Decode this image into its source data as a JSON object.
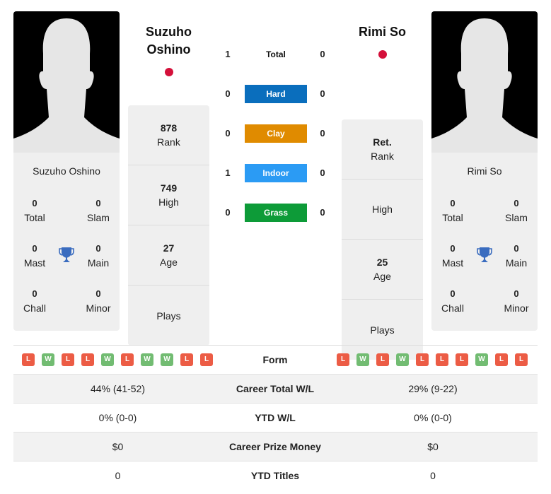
{
  "colors": {
    "hard": "#0a6ebd",
    "clay": "#e08b00",
    "indoor": "#2b9bf4",
    "grass": "#0d9b38",
    "loss": "#ec5c45",
    "win": "#72bc72",
    "flag": "#d4103a",
    "trophy": "#3a6cbf"
  },
  "player1": {
    "name_line1": "Suzuho",
    "name_line2": "Oshino",
    "card_name": "Suzuho Oshino",
    "titles": {
      "total": {
        "value": "0",
        "label": "Total"
      },
      "slam": {
        "value": "0",
        "label": "Slam"
      },
      "mast": {
        "value": "0",
        "label": "Mast"
      },
      "main": {
        "value": "0",
        "label": "Main"
      },
      "chall": {
        "value": "0",
        "label": "Chall"
      },
      "minor": {
        "value": "0",
        "label": "Minor"
      }
    },
    "info": {
      "rank": {
        "value": "878",
        "label": "Rank"
      },
      "high": {
        "value": "749",
        "label": "High"
      },
      "age": {
        "value": "27",
        "label": "Age"
      },
      "plays": {
        "value": "",
        "label": "Plays"
      }
    },
    "form": [
      "L",
      "W",
      "L",
      "L",
      "W",
      "L",
      "W",
      "W",
      "L",
      "L"
    ]
  },
  "player2": {
    "name": "Rimi So",
    "card_name": "Rimi So",
    "titles": {
      "total": {
        "value": "0",
        "label": "Total"
      },
      "slam": {
        "value": "0",
        "label": "Slam"
      },
      "mast": {
        "value": "0",
        "label": "Mast"
      },
      "main": {
        "value": "0",
        "label": "Main"
      },
      "chall": {
        "value": "0",
        "label": "Chall"
      },
      "minor": {
        "value": "0",
        "label": "Minor"
      }
    },
    "info": {
      "rank": {
        "value": "Ret.",
        "label": "Rank"
      },
      "high": {
        "value": "",
        "label": "High"
      },
      "age": {
        "value": "25",
        "label": "Age"
      },
      "plays": {
        "value": "",
        "label": "Plays"
      }
    },
    "form": [
      "L",
      "W",
      "L",
      "W",
      "L",
      "L",
      "L",
      "W",
      "L",
      "L"
    ]
  },
  "h2h": {
    "total": {
      "label": "Total",
      "p1": "1",
      "p2": "0"
    },
    "hard": {
      "label": "Hard",
      "p1": "0",
      "p2": "0"
    },
    "clay": {
      "label": "Clay",
      "p1": "0",
      "p2": "0"
    },
    "indoor": {
      "label": "Indoor",
      "p1": "1",
      "p2": "0"
    },
    "grass": {
      "label": "Grass",
      "p1": "0",
      "p2": "0"
    }
  },
  "table": {
    "form_label": "Form",
    "rows": [
      {
        "label": "Career Total W/L",
        "p1": "44% (41-52)",
        "p2": "29% (9-22)"
      },
      {
        "label": "YTD W/L",
        "p1": "0% (0-0)",
        "p2": "0% (0-0)"
      },
      {
        "label": "Career Prize Money",
        "p1": "$0",
        "p2": "$0"
      },
      {
        "label": "YTD Titles",
        "p1": "0",
        "p2": "0"
      }
    ]
  }
}
